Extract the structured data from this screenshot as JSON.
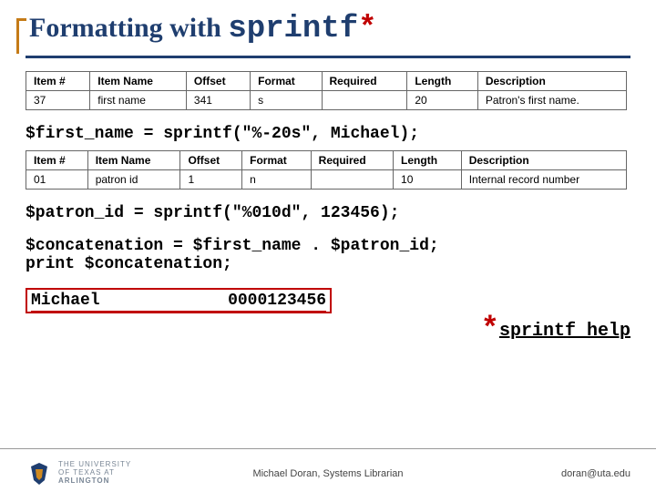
{
  "title": {
    "prefix": "Formatting with ",
    "mono": "sprintf",
    "asterisk": "*"
  },
  "tables": {
    "headers": [
      "Item #",
      "Item Name",
      "Offset",
      "Format",
      "Required",
      "Length",
      "Description"
    ],
    "row1": [
      "37",
      "first name",
      "341",
      "s",
      "",
      "20",
      "Patron's first name."
    ],
    "row2": [
      "01",
      "patron id",
      "1",
      "n",
      "",
      "10",
      "Internal record number"
    ]
  },
  "code1": "$first_name = sprintf(\"%-20s\", Michael);",
  "code2": "$patron_id = sprintf(\"%010d\", 123456);",
  "code3a": "$concatenation = $first_name . $patron_id;",
  "code3b": "print $concatenation;",
  "output": {
    "part1": "Michael",
    "pad": "             ",
    "part2": "0000123456"
  },
  "helpnote": {
    "asterisk": "*",
    "text": "sprintf help"
  },
  "footer": {
    "center": "Michael Doran, Systems Librarian",
    "right": "doran@uta.edu",
    "logo_text": "THE UNIVERSITY OF TEXAS AT ARLINGTON"
  },
  "chart_data": {
    "type": "table",
    "headers": [
      "Item #",
      "Item Name",
      "Offset",
      "Format",
      "Required",
      "Length",
      "Description"
    ],
    "rows": [
      [
        "37",
        "first name",
        "341",
        "s",
        "",
        "20",
        "Patron's first name."
      ],
      [
        "01",
        "patron id",
        "1",
        "n",
        "",
        "10",
        "Internal record number"
      ]
    ]
  }
}
